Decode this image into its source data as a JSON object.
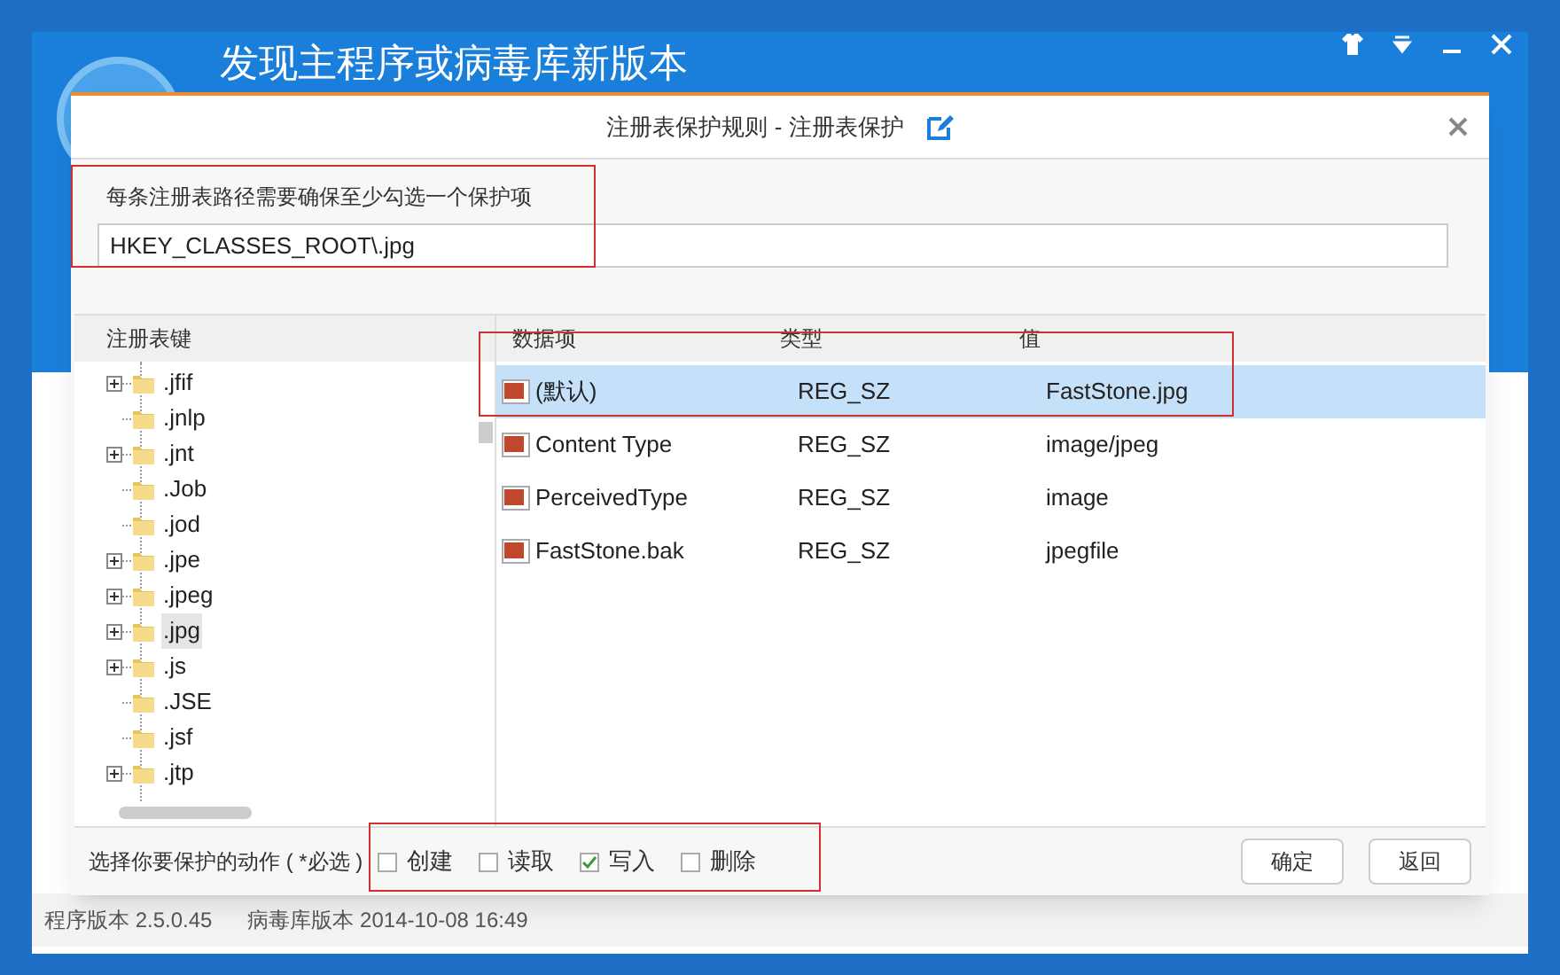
{
  "app": {
    "title": "发现主程序或病毒库新版本",
    "status_bar": [
      "程序版本 2.5.0.45",
      "病毒库版本 2014-10-08 16:49"
    ]
  },
  "dialog": {
    "title": "注册表保护规则 - 注册表保护",
    "hint": "每条注册表路径需要确保至少勾选一个保护项",
    "path": "HKEY_CLASSES_ROOT\\.jpg",
    "tree": {
      "heading": "注册表键",
      "items": [
        {
          "label": ".jfif",
          "expandable": true,
          "selected": false
        },
        {
          "label": ".jnlp",
          "expandable": false,
          "selected": false
        },
        {
          "label": ".jnt",
          "expandable": true,
          "selected": false
        },
        {
          "label": ".Job",
          "expandable": false,
          "selected": false
        },
        {
          "label": ".jod",
          "expandable": false,
          "selected": false
        },
        {
          "label": ".jpe",
          "expandable": true,
          "selected": false
        },
        {
          "label": ".jpeg",
          "expandable": true,
          "selected": false
        },
        {
          "label": ".jpg",
          "expandable": true,
          "selected": true
        },
        {
          "label": ".js",
          "expandable": true,
          "selected": false
        },
        {
          "label": ".JSE",
          "expandable": false,
          "selected": false
        },
        {
          "label": ".jsf",
          "expandable": false,
          "selected": false
        },
        {
          "label": ".jtp",
          "expandable": true,
          "selected": false
        }
      ]
    },
    "table": {
      "columns": [
        "数据项",
        "类型",
        "值"
      ],
      "rows": [
        {
          "name": "(默认)",
          "type": "REG_SZ",
          "value": "FastStone.jpg",
          "selected": true
        },
        {
          "name": "Content Type",
          "type": "REG_SZ",
          "value": "image/jpeg",
          "selected": false
        },
        {
          "name": "PerceivedType",
          "type": "REG_SZ",
          "value": "image",
          "selected": false
        },
        {
          "name": "FastStone.bak",
          "type": "REG_SZ",
          "value": "jpegfile",
          "selected": false
        }
      ]
    },
    "actions_label": "选择你要保护的动作 ( *必选 )",
    "actions": [
      {
        "label": "创建",
        "checked": false
      },
      {
        "label": "读取",
        "checked": false
      },
      {
        "label": "写入",
        "checked": true
      },
      {
        "label": "删除",
        "checked": false
      }
    ],
    "buttons": [
      "确定",
      "返回"
    ]
  }
}
